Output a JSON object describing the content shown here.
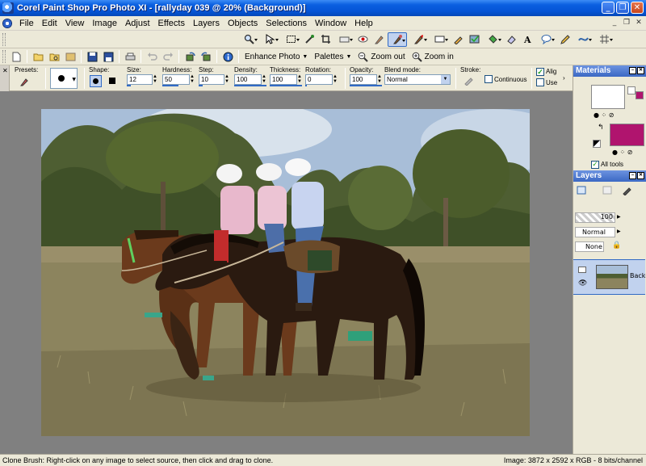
{
  "window": {
    "title": "Corel Paint Shop Pro Photo XI - [rallyday 039 @  20% (Background)]"
  },
  "menu": [
    "File",
    "Edit",
    "View",
    "Image",
    "Adjust",
    "Effects",
    "Layers",
    "Objects",
    "Selections",
    "Window",
    "Help"
  ],
  "standard_toolbar": {
    "enhance_photo": "Enhance Photo",
    "palettes": "Palettes",
    "zoom_out": "Zoom out",
    "zoom_in": "Zoom in"
  },
  "tool_options": {
    "presets_label": "Presets:",
    "shape_label": "Shape:",
    "size_label": "Size:",
    "size_value": "12",
    "hardness_label": "Hardness:",
    "hardness_value": "50",
    "step_label": "Step:",
    "step_value": "10",
    "density_label": "Density:",
    "density_value": "100",
    "thickness_label": "Thickness:",
    "thickness_value": "100",
    "rotation_label": "Rotation:",
    "rotation_value": "0",
    "opacity_label": "Opacity:",
    "opacity_value": "100",
    "blend_label": "Blend mode:",
    "blend_value": "Normal",
    "stroke_label": "Stroke:",
    "continuous_label": "Continuous",
    "align_label": "Alig",
    "use_label": "Use"
  },
  "materials": {
    "title": "Materials",
    "foreground_color": "#ffffff",
    "background_color": "#b0146e",
    "all_tools_label": "All tools"
  },
  "layers": {
    "title": "Layers",
    "opacity_value": "100",
    "blend_value": "Normal",
    "mask_value": "None",
    "layer_name": "Backg"
  },
  "status": {
    "hint": "Clone Brush: Right-click on any image to select source, then click and drag to clone.",
    "image_info": "Image:  3872 x 2592 x RGB - 8 bits/channel"
  }
}
